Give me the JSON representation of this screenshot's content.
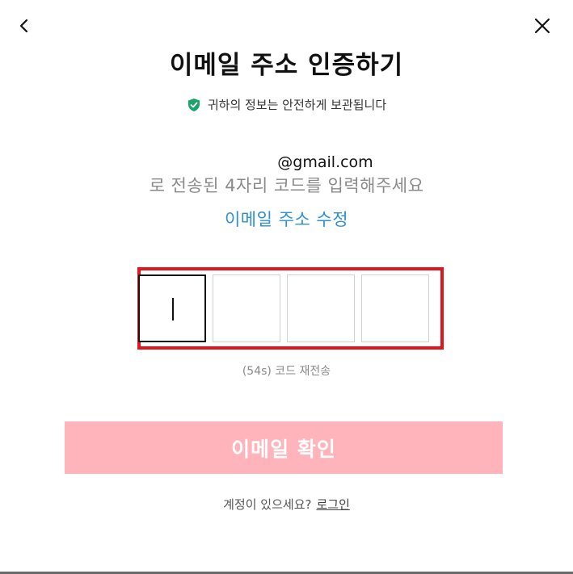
{
  "header": {
    "back_icon": "chevron-left-icon",
    "close_icon": "close-icon",
    "title": "이메일 주소 인증하기",
    "secure_icon": "shield-check-icon",
    "secure_text": "귀하의 정보는 안전하게 보관됩니다"
  },
  "verification": {
    "email_suffix": "@gmail.com",
    "sent_message": "로 전송된 4자리 코드를 입력해주세요",
    "edit_email_link": "이메일 주소 수정",
    "code_digits": [
      "",
      "",
      "",
      ""
    ],
    "active_index": 0,
    "resend_text": "(54s) 코드 재전송"
  },
  "actions": {
    "confirm_label": "이메일 확인",
    "account_question": "계정이 있으세요?",
    "login_link": "로그인"
  },
  "colors": {
    "accent_green": "#1aa46b",
    "link_blue": "#2d8fd5",
    "button_disabled_pink": "#ffb4bb",
    "highlight_red": "#e0161e"
  }
}
